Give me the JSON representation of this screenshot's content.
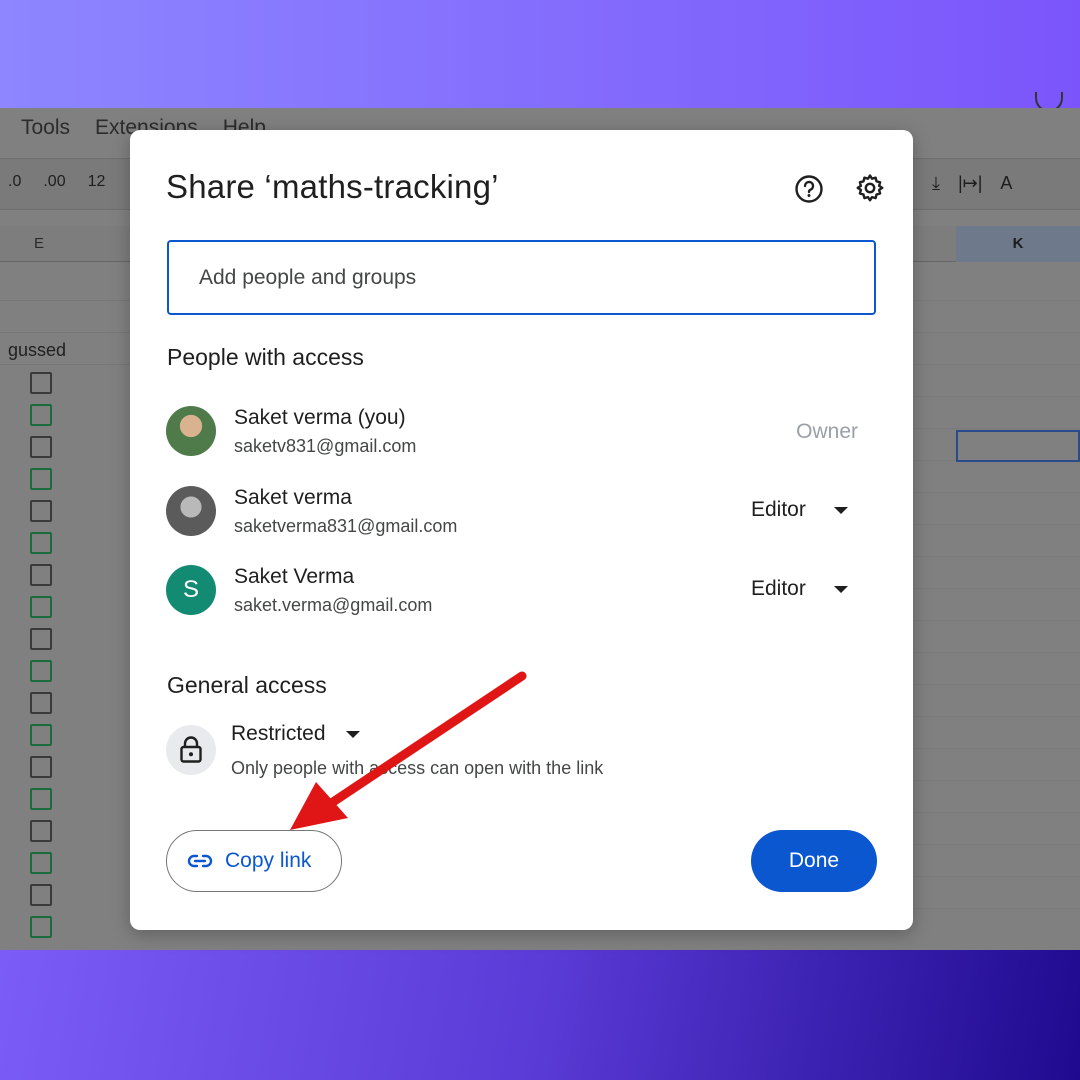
{
  "sheet": {
    "menu": [
      "Tools",
      "Extensions",
      "Help"
    ],
    "toolbar_left": [
      ".0",
      ".00",
      "12"
    ],
    "toolbar_right": [
      "⤓",
      "|↦|",
      "A"
    ],
    "col_e": "E",
    "col_k": "K",
    "cell_text": "gussed"
  },
  "dialog": {
    "title": "Share ‘maths-tracking’",
    "help_icon": "help-icon",
    "settings_icon": "gear-icon",
    "input_placeholder": "Add people and groups",
    "people_title": "People with access",
    "people": [
      {
        "name": "Saket verma (you)",
        "email": "saketv831@gmail.com",
        "role": "Owner"
      },
      {
        "name": "Saket verma",
        "email": "saketverma831@gmail.com",
        "role": "Editor"
      },
      {
        "name": "Saket Verma",
        "email": "saket.verma@gmail.com",
        "role": "Editor",
        "initial": "S"
      }
    ],
    "general_title": "General access",
    "access_level": "Restricted",
    "access_desc": "Only people with access can open with the link",
    "copy_link": "Copy link",
    "done": "Done"
  },
  "colors": {
    "primary": "#0b57d0",
    "avatar_s": "#138a72",
    "arrow": "#e01515"
  }
}
